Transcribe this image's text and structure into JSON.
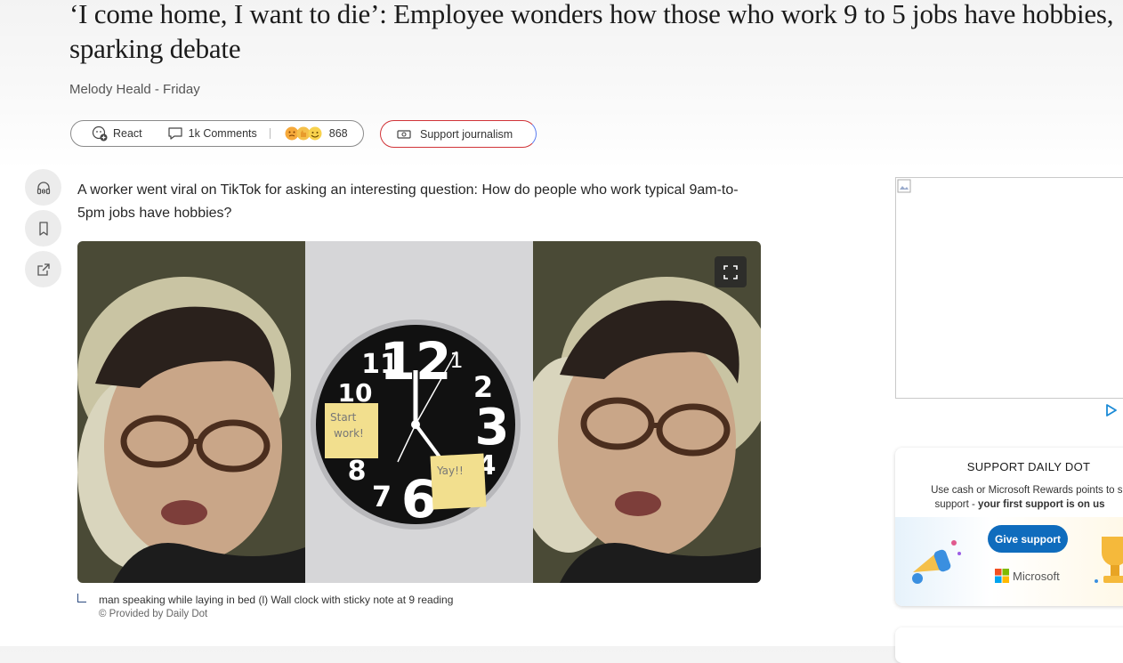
{
  "article": {
    "headline": "‘I come home, I want to die’: Employee wonders how those who work 9 to 5 jobs have hobbies, sparking debate",
    "byline": "Melody Heald - Friday",
    "lead": "A worker went viral on TikTok for asking an interesting question: How do people who work typical 9am-to-5pm jobs have hobbies?"
  },
  "actions": {
    "react_label": "React",
    "comments_label": "1k Comments",
    "reactions_count": "868",
    "support_label": "Support journalism"
  },
  "media": {
    "sticky_left": "Start work!",
    "sticky_right": "Yay!!",
    "clock_numbers": [
      "11",
      "12",
      "1",
      "2",
      "3",
      "4",
      "6",
      "7",
      "8",
      "10"
    ],
    "caption": "man speaking while laying in bed (l) Wall clock with sticky note at 9 reading",
    "credit": "© Provided by Daily Dot"
  },
  "sidebar": {
    "support_title": "SUPPORT DAILY DOT",
    "support_desc": "Use cash or Microsoft Rewards points to se",
    "support_desc2_prefix": "support - ",
    "support_desc2_bold": "your first support is on us",
    "give_label": "Give support",
    "brand": "Microsoft"
  },
  "colors": {
    "accent_blue": "#0f6cbd",
    "support_border": "#d13438"
  },
  "icons": [
    "headphones-icon",
    "bookmark-icon",
    "share-icon",
    "react-icon",
    "comment-icon",
    "money-icon",
    "expand-icon",
    "adchoices-icon"
  ]
}
